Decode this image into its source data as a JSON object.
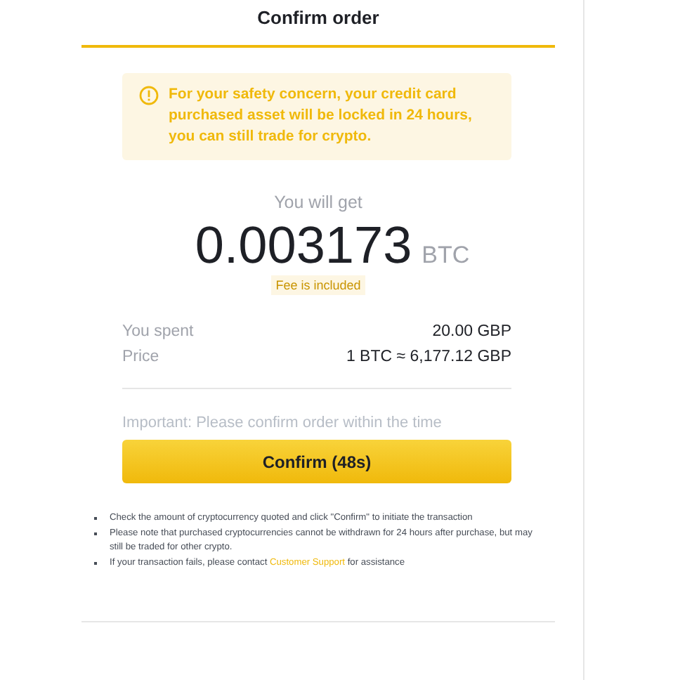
{
  "title": "Confirm order",
  "warning": {
    "text": "For your safety concern, your credit card purchased asset will be locked in 24 hours, you can still trade for crypto."
  },
  "receive": {
    "label": "You will get",
    "amount": "0.003173",
    "unit": "BTC",
    "badge": "Fee is included"
  },
  "details": [
    {
      "label": "You spent",
      "value": "20.00 GBP"
    },
    {
      "label": "Price",
      "value": "1 BTC ≈ 6,177.12 GBP"
    }
  ],
  "important": "Important: Please confirm order within the time",
  "confirm_button": "Confirm (48s)",
  "notes": [
    {
      "text": "Check the amount of cryptocurrency quoted and click \"Confirm\" to initiate the transaction"
    },
    {
      "text": "Please note that purchased cryptocurrencies cannot be withdrawn for 24 hours after purchase, but may still be traded for other crypto."
    },
    {
      "text": "If your transaction fails, please contact",
      "link": "Customer Support",
      "after": "for assistance"
    }
  ]
}
